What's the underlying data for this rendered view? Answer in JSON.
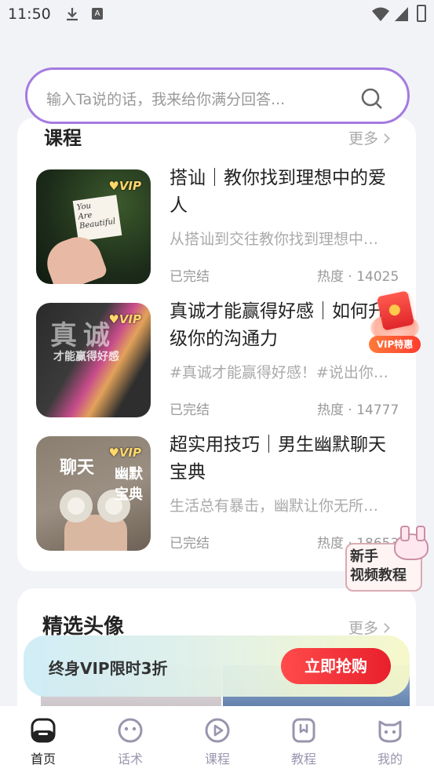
{
  "status_bar": {
    "time": "11:50",
    "a_icon": "A"
  },
  "search": {
    "placeholder": "输入Ta说的话，我来给你满分回答..."
  },
  "courses_section": {
    "title": "课程",
    "more": "更多",
    "items": [
      {
        "title": "搭讪｜教你找到理想中的爱人",
        "desc": "从搭讪到交往教你找到理想中的爱人",
        "status": "已完结",
        "heat": "热度 · 14025",
        "badge": "VIP",
        "thumb_text": [
          "You",
          "Are",
          "Beautiful"
        ]
      },
      {
        "title": "真诚才能赢得好感｜如何升级你的沟通力",
        "desc": "#真诚才能赢得好感！#说出你的心声",
        "status": "已完结",
        "heat": "热度 · 14777",
        "badge": "VIP",
        "thumb_text": [
          "真诚",
          "才能赢得好感"
        ]
      },
      {
        "title": "超实用技巧｜男生幽默聊天宝典",
        "desc": "生活总有暴击，幽默让你无所畏惧",
        "status": "已完结",
        "heat": "热度 · 18653",
        "badge": "VIP",
        "thumb_text": [
          "聊天",
          "幽默宝典"
        ]
      }
    ]
  },
  "avatars_section": {
    "title": "精选头像",
    "more": "更多"
  },
  "vip_banner": {
    "text": "终身VIP限时3折",
    "button": "立即抢购"
  },
  "float_vip": {
    "label": "VIP特惠"
  },
  "float_video": {
    "line1": "新手",
    "line2": "视频教程"
  },
  "tabbar": {
    "items": [
      {
        "label": "首页",
        "icon": "home-icon",
        "active": true
      },
      {
        "label": "话术",
        "icon": "chat-face-icon",
        "active": false
      },
      {
        "label": "课程",
        "icon": "play-icon",
        "active": false
      },
      {
        "label": "教程",
        "icon": "bookmark-icon",
        "active": false
      },
      {
        "label": "我的",
        "icon": "cat-face-icon",
        "active": false
      }
    ]
  },
  "colors": {
    "accent": "#a57be0",
    "red": "#e8202c",
    "tab_inactive": "#9a95ae"
  }
}
